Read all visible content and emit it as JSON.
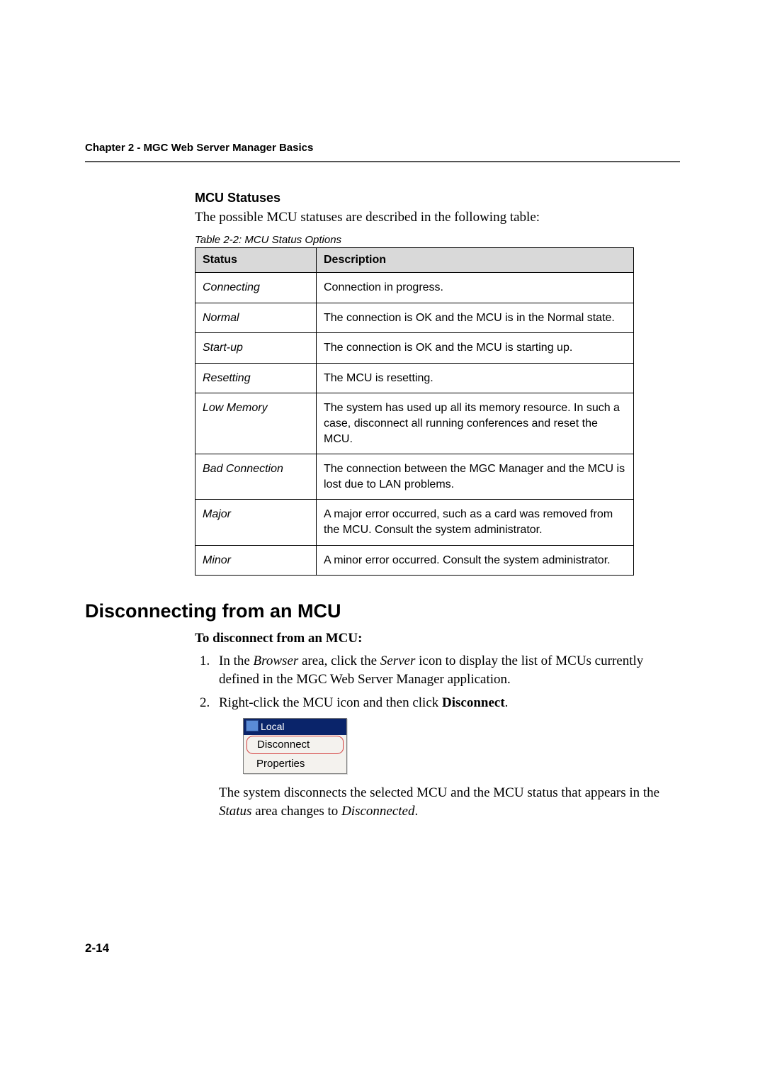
{
  "header": {
    "chapter_line": "Chapter 2 - MGC Web Server Manager Basics"
  },
  "section_mcu_statuses": {
    "heading": "MCU Statuses",
    "intro": "The possible MCU statuses are described in the following table:",
    "table_caption": "Table 2-2: MCU Status Options",
    "columns": {
      "status": "Status",
      "description": "Description"
    },
    "rows": [
      {
        "status": "Connecting",
        "description": "Connection in progress."
      },
      {
        "status": "Normal",
        "description": "The connection is OK and the MCU is in the Normal state."
      },
      {
        "status": "Start-up",
        "description": "The connection is OK and the MCU is starting up."
      },
      {
        "status": "Resetting",
        "description": "The MCU is resetting."
      },
      {
        "status": "Low Memory",
        "description": "The system has used up all its memory resource. In such a case, disconnect all running conferences and reset the MCU."
      },
      {
        "status": "Bad Connection",
        "description": "The connection between the MGC Manager and the MCU is lost due to LAN problems."
      },
      {
        "status": "Major",
        "description": "A major error occurred, such as a card was removed from the MCU. Consult the system administrator."
      },
      {
        "status": "Minor",
        "description": "A minor error occurred. Consult the system administrator."
      }
    ]
  },
  "section_disconnect": {
    "heading": "Disconnecting from an MCU",
    "procedure_heading": "To disconnect from an MCU:",
    "step1": {
      "pre": "In the ",
      "i1": "Browser",
      "mid1": " area, click the ",
      "i2": "Server",
      "post": " icon to display the list of MCUs currently defined in the MGC Web Server Manager application."
    },
    "step2": {
      "pre": "Right-click the MCU icon and then click ",
      "b1": "Disconnect",
      "post": "."
    },
    "menu": {
      "title": "Local",
      "item_disconnect": "Disconnect",
      "item_properties": "Properties"
    },
    "result": {
      "pre": "The system disconnects the selected MCU and the MCU status that appears in the ",
      "i1": "Status",
      "mid": " area changes to ",
      "i2": "Disconnected",
      "post": "."
    }
  },
  "footer": {
    "page_number": "2-14"
  }
}
